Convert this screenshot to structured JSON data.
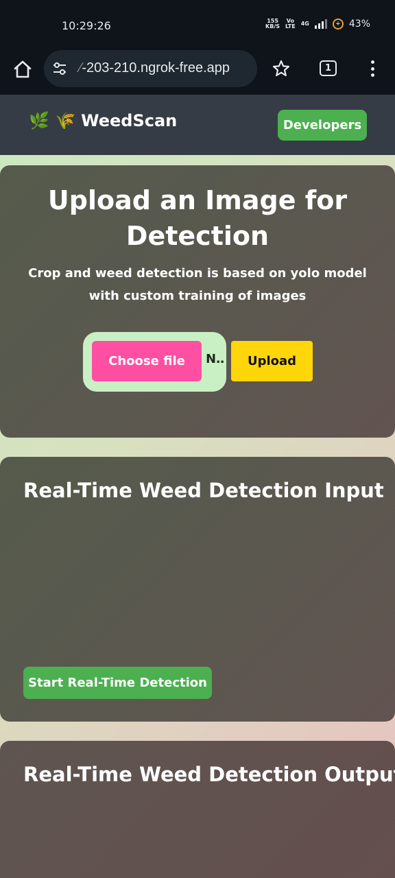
{
  "status_bar": {
    "time": "10:29:26",
    "net_speed_top": "155",
    "net_speed_bottom": "KB/S",
    "volte_top": "Vo",
    "volte_bottom": "LTE",
    "network": "4G",
    "battery": "43%"
  },
  "browser": {
    "url_faded": "⁄",
    "url": "-203-210.ngrok-free.app",
    "tab_count": "1",
    "icons": [
      "home-icon",
      "tune-icon",
      "star-icon",
      "tabs-icon",
      "more-vert-icon"
    ]
  },
  "nav": {
    "brand_emoji": "🌿 🌾",
    "brand_name": "WeedScan",
    "developers_label": "Developers"
  },
  "upload": {
    "title": "Upload an Image for Detection",
    "description": "Crop and weed detection is based on yolo model with custom training of images",
    "choose_label": "Choose file",
    "file_name": "N…",
    "upload_label": "Upload"
  },
  "realtime_input": {
    "title": "Real-Time Weed Detection Input",
    "button_label": "Start Real-Time Detection"
  },
  "realtime_output": {
    "title": "Real-Time Weed Detection Output"
  },
  "colors": {
    "developers_button": "#4caf50",
    "choose_button": "#ff4fa3",
    "upload_button": "#ffd60a",
    "nav_bg": "#353c45"
  }
}
